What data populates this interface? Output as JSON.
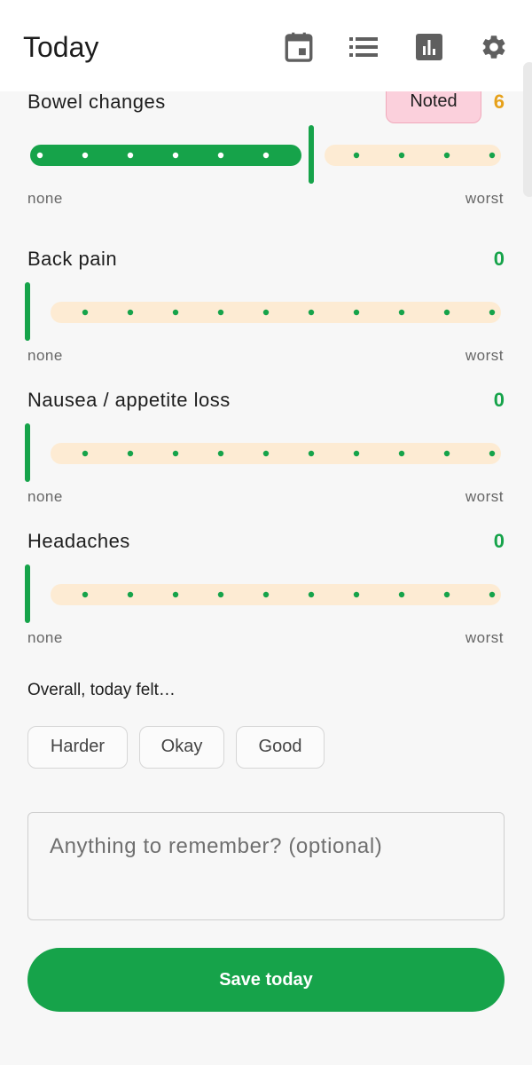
{
  "appbar": {
    "title": "Today",
    "icons": [
      "calendar-icon",
      "list-icon",
      "chart-icon",
      "gear-icon"
    ]
  },
  "scale": {
    "min_label": "none",
    "max_label": "worst",
    "max_value": 10
  },
  "symptoms": [
    {
      "label": "Bowel changes",
      "value": 6,
      "value_text": "6",
      "badge": "Noted"
    },
    {
      "label": "Back pain",
      "value": 0,
      "value_text": "0"
    },
    {
      "label": "Nausea / appetite loss",
      "value": 0,
      "value_text": "0"
    },
    {
      "label": "Headaches",
      "value": 0,
      "value_text": "0"
    }
  ],
  "overall": {
    "prompt": "Overall, today felt…",
    "options": [
      "Harder",
      "Okay",
      "Good"
    ]
  },
  "note": {
    "placeholder": "Anything to remember? (optional)",
    "value": ""
  },
  "save_label": "Save today",
  "colors": {
    "accent": "#16a34a",
    "track": "#fdebd3",
    "warning": "#e6a11a",
    "badge_bg": "#fbd0dc"
  }
}
